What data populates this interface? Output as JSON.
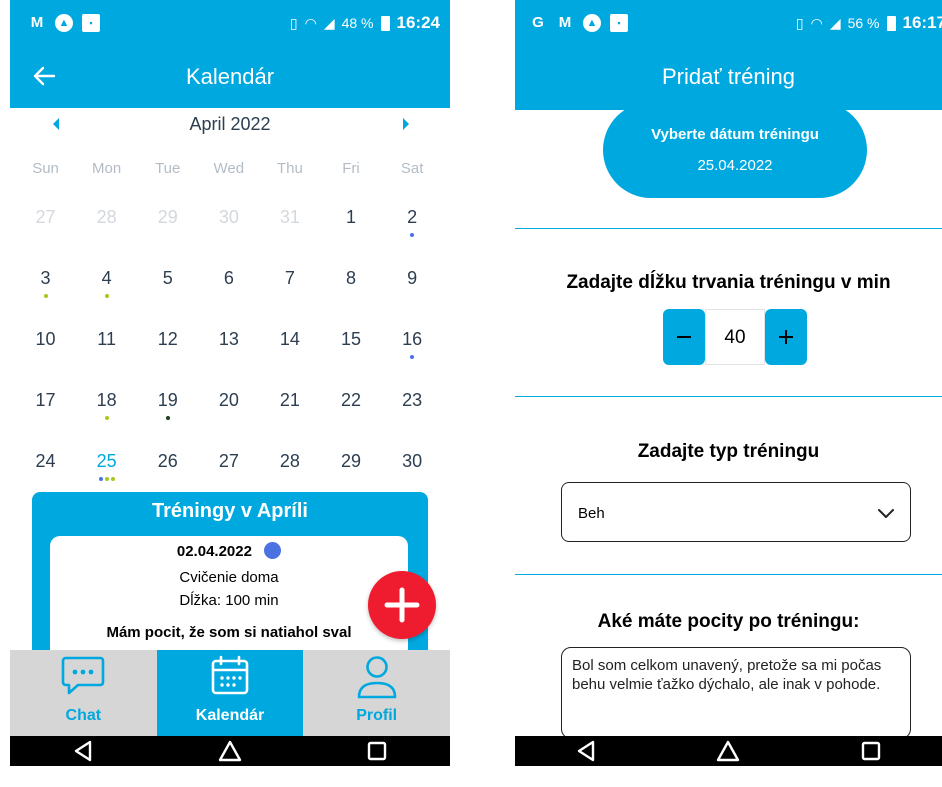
{
  "colors": {
    "accent": "#00a8e0",
    "fab": "#ee1c2e",
    "nav_inactive_bg": "#d6d6d6",
    "dot_blue": "#4a72e0",
    "dot_green": "#a8c820",
    "dot_dark": "#1f4028"
  },
  "left": {
    "status": {
      "icons": [
        "gmail-icon",
        "app-icon",
        "image-icon"
      ],
      "battery": "48 %",
      "time": "16:24"
    },
    "appbar": {
      "title": "Kalendár",
      "back_icon": "arrow-left-icon"
    },
    "calendar": {
      "month": "April 2022",
      "weekdays": [
        "Sun",
        "Mon",
        "Tue",
        "Wed",
        "Thu",
        "Fri",
        "Sat"
      ],
      "weeks": [
        [
          {
            "d": "27",
            "other": true
          },
          {
            "d": "28",
            "other": true
          },
          {
            "d": "29",
            "other": true
          },
          {
            "d": "30",
            "other": true
          },
          {
            "d": "31",
            "other": true
          },
          {
            "d": "1"
          },
          {
            "d": "2",
            "dots": [
              "blue"
            ]
          }
        ],
        [
          {
            "d": "3",
            "dots": [
              "green"
            ]
          },
          {
            "d": "4",
            "dots": [
              "green"
            ]
          },
          {
            "d": "5"
          },
          {
            "d": "6"
          },
          {
            "d": "7"
          },
          {
            "d": "8"
          },
          {
            "d": "9"
          }
        ],
        [
          {
            "d": "10"
          },
          {
            "d": "11"
          },
          {
            "d": "12"
          },
          {
            "d": "13"
          },
          {
            "d": "14"
          },
          {
            "d": "15"
          },
          {
            "d": "16",
            "dots": [
              "blue"
            ]
          }
        ],
        [
          {
            "d": "17"
          },
          {
            "d": "18",
            "dots": [
              "green"
            ]
          },
          {
            "d": "19",
            "dots": [
              "dark"
            ]
          },
          {
            "d": "20"
          },
          {
            "d": "21"
          },
          {
            "d": "22"
          },
          {
            "d": "23"
          }
        ],
        [
          {
            "d": "24"
          },
          {
            "d": "25",
            "today": true,
            "dots": [
              "blue",
              "green",
              "green"
            ]
          },
          {
            "d": "26"
          },
          {
            "d": "27"
          },
          {
            "d": "28"
          },
          {
            "d": "29"
          },
          {
            "d": "30"
          }
        ]
      ]
    },
    "card": {
      "title": "Tréningy v Apríli",
      "entry": {
        "date": "02.04.2022",
        "type": "Cvičenie doma",
        "duration": "Dĺžka: 100 min",
        "feeling": "Mám pocit, že som si natiahol sval"
      }
    },
    "fab_icon": "plus-icon",
    "nav": [
      {
        "label": "Chat",
        "icon": "chat-icon",
        "active": false
      },
      {
        "label": "Kalendár",
        "icon": "calendar-icon",
        "active": true
      },
      {
        "label": "Profil",
        "icon": "person-icon",
        "active": false
      }
    ]
  },
  "right": {
    "status": {
      "icons": [
        "google-icon",
        "gmail-icon",
        "app-icon",
        "image-icon"
      ],
      "battery": "56 %",
      "time": "16:17"
    },
    "appbar": {
      "title": "Pridať tréning"
    },
    "date_picker": {
      "label": "Vyberte dátum tréningu",
      "value": "25.04.2022"
    },
    "duration": {
      "title": "Zadajte dĺžku trvania tréningu v min",
      "value": "40"
    },
    "type": {
      "title": "Zadajte typ tréningu",
      "value": "Beh"
    },
    "feelings": {
      "title": "Aké máte pocity po tréningu:",
      "value": "Bol som celkom unavený, pretože sa mi počas behu velmie ťažko dýchalo, ale inak v pohode."
    }
  },
  "android_nav": [
    "back-icon",
    "home-icon",
    "recents-icon"
  ]
}
